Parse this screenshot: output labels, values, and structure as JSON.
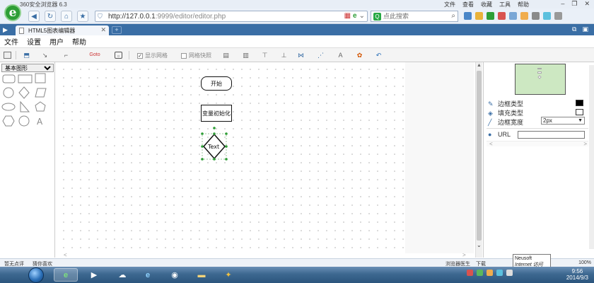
{
  "browser": {
    "app_name": "360安全浏览器 6.3",
    "menu": [
      "文件",
      "查看",
      "收藏",
      "工具",
      "帮助"
    ],
    "address_host": "http://127.0.0.1",
    "address_rest": ":9999/editor/editor.php",
    "search_placeholder": "点此搜索",
    "tab_label": "HTML5图表编辑器"
  },
  "app_menu": [
    "文件",
    "设置",
    "用户",
    "帮助"
  ],
  "toolbar": {
    "show_grid_label": "显示网格",
    "grid_snap_label": "网格快照",
    "goto_label": "Goto",
    "show_grid_checked": "✓"
  },
  "palette": {
    "category": "基本图形",
    "text_shape_glyph": "A"
  },
  "canvas": {
    "nodes": {
      "start": "开始",
      "init": "变量初始化",
      "decision": "Text"
    }
  },
  "properties": {
    "border_type": "边框类型",
    "fill_type": "填充类型",
    "border_width": "边框宽度",
    "border_width_value": "2px",
    "url_label": "URL",
    "border_color": "#000000",
    "fill_color": "#ffffff"
  },
  "status": {
    "left": [
      "暂无点评",
      "猜你喜欢"
    ],
    "right": [
      "浏览器医生",
      "下载"
    ],
    "zoom": "100%",
    "tooltip_line1": "Neusoft",
    "tooltip_line2": "Internet 访问"
  },
  "clock": {
    "time": "9:56",
    "date": "2014/9/3"
  },
  "colors": {
    "accent": "#3a6ea5",
    "brand_green": "#2e9e36",
    "minimap_bg": "#cde8c2"
  }
}
